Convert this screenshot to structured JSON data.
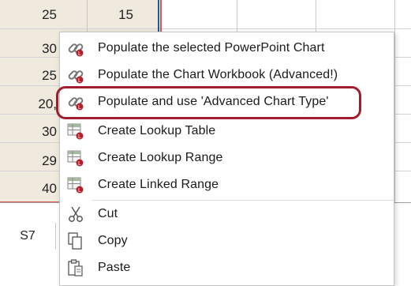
{
  "sheet": {
    "rows": [
      {
        "a": "25",
        "b": "15"
      },
      {
        "a": "30",
        "b": ""
      },
      {
        "a": "25",
        "b": ""
      },
      {
        "a": "20,",
        "b": ""
      },
      {
        "a": "30",
        "b": ""
      },
      {
        "a": "29",
        "b": ""
      },
      {
        "a": "40",
        "b": ""
      }
    ],
    "name_box": "S7"
  },
  "menu": {
    "items": [
      {
        "label": "Populate the selected PowerPoint Chart",
        "icon": "link-icon"
      },
      {
        "label": "Populate the Chart Workbook (Advanced!)",
        "icon": "link-icon"
      },
      {
        "label": "Populate and use 'Advanced Chart Type'",
        "icon": "link-icon"
      },
      {
        "label": "Create Lookup Table",
        "icon": "table-icon"
      },
      {
        "label": "Create Lookup Range",
        "icon": "table-icon"
      },
      {
        "label": "Create Linked Range",
        "icon": "table-icon"
      },
      {
        "label": "Cut",
        "icon": "scissors-icon"
      },
      {
        "label": "Copy",
        "icon": "copy-icon"
      },
      {
        "label": "Paste",
        "icon": "paste-icon"
      }
    ]
  },
  "colors": {
    "highlight": "#a01d2f",
    "selection": "#1e5b9c"
  }
}
